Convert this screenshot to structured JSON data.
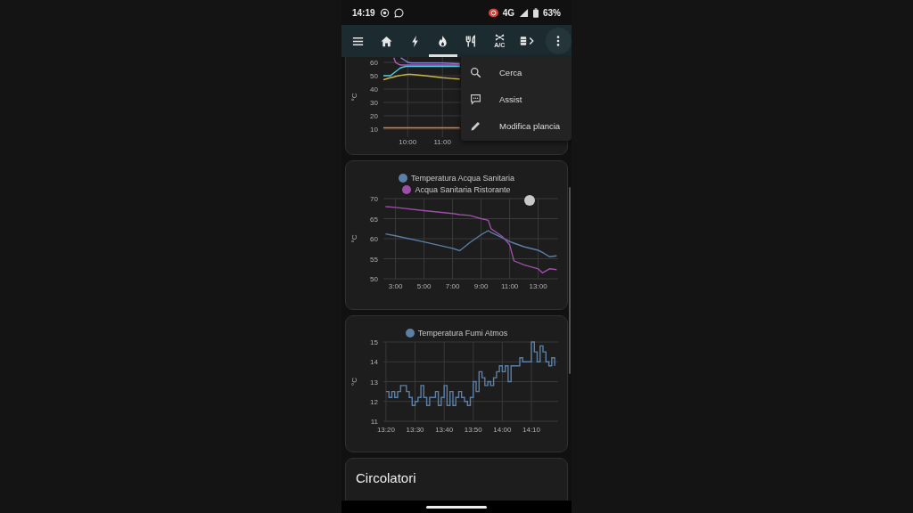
{
  "status_bar": {
    "time": "14:19",
    "network": "4G",
    "battery": "63%"
  },
  "nav_items": [
    {
      "kind": "menu",
      "selected": false
    },
    {
      "kind": "home",
      "selected": false
    },
    {
      "kind": "bolt",
      "selected": false
    },
    {
      "kind": "fire",
      "selected": true
    },
    {
      "kind": "cutlery",
      "selected": false
    },
    {
      "kind": "fan",
      "label": "A/C",
      "selected": false
    },
    {
      "kind": "device",
      "selected": false
    }
  ],
  "overflow_menu": {
    "items": [
      {
        "kind": "search",
        "label": "Cerca"
      },
      {
        "kind": "assist",
        "label": "Assist"
      },
      {
        "kind": "edit",
        "label": "Modifica plancia"
      }
    ]
  },
  "cards": [
    {
      "chart_data": {
        "type": "line",
        "grid": true,
        "ylabel": "°C",
        "x": [
          9.3,
          9.5,
          9.6,
          9.65,
          9.75,
          9.8,
          9.95,
          10,
          10.1,
          10.5,
          11,
          11.5
        ],
        "xlim": [
          9.3,
          14.33
        ],
        "ylim": [
          4,
          64
        ],
        "yticks": [
          10,
          20,
          30,
          40,
          50,
          60
        ],
        "xticks": [
          {
            "value": 10,
            "label": "10:00"
          },
          {
            "value": 11,
            "label": "11:00"
          }
        ],
        "series": [
          {
            "color": "#b05cc0",
            "values": [
              null,
              null,
              63.5,
              60,
              58.5,
              58,
              58,
              58,
              58,
              58,
              58,
              58
            ]
          },
          {
            "color": "#7c7fd0",
            "values": [
              null,
              null,
              null,
              null,
              null,
              63.5,
              61,
              60,
              59.5,
              59.5,
              59.5,
              59
            ]
          },
          {
            "color": "#4dd0e1",
            "values": [
              50,
              50,
              52,
              53,
              55,
              56,
              57,
              57,
              57,
              57,
              57,
              57
            ]
          },
          {
            "color": "#c8b84a",
            "values": [
              47,
              48.5,
              49,
              49.5,
              50,
              50.3,
              50.8,
              51,
              51,
              50,
              48.5,
              47.5
            ]
          },
          {
            "color": "#e07b39",
            "values": [
              11,
              11,
              11,
              11,
              11,
              11,
              11,
              11,
              11,
              11,
              11,
              11
            ]
          }
        ]
      }
    },
    {
      "chart_data": {
        "type": "line",
        "grid": true,
        "ylabel": "°C",
        "x": [
          2.3,
          3,
          5,
          7,
          7.5,
          8.2,
          9,
          9.5,
          9.7,
          10.5,
          11,
          11.3,
          12,
          13,
          13.3,
          13.8,
          14.3
        ],
        "xlim": [
          2.15,
          14.4
        ],
        "ylim": [
          50,
          70
        ],
        "yticks": [
          50,
          55,
          60,
          65,
          70
        ],
        "xticks": [
          {
            "value": 3,
            "label": "3:00"
          },
          {
            "value": 5,
            "label": "5:00"
          },
          {
            "value": 7,
            "label": "7:00"
          },
          {
            "value": 9,
            "label": "9:00"
          },
          {
            "value": 11,
            "label": "11:00"
          },
          {
            "value": 13,
            "label": "13:00"
          }
        ],
        "series": [
          {
            "name": "Temperatura Acqua Sanitaria",
            "color": "#5b7fa6",
            "values": [
              61.2,
              60.7,
              59.2,
              57.6,
              57,
              59,
              61,
              62,
              61.6,
              60.2,
              59.3,
              58.9,
              58,
              57.1,
              56.6,
              55.5,
              55.7
            ]
          },
          {
            "name": "Acqua Sanitaria Ristorante",
            "color": "#9c4fa8",
            "values": [
              68,
              67.8,
              67,
              66.3,
              66,
              65.8,
              65,
              64.6,
              62.5,
              60.5,
              58.5,
              54.5,
              53.5,
              52.5,
              51.5,
              52.5,
              52.3
            ]
          }
        ]
      }
    },
    {
      "chart_data": {
        "type": "line",
        "grid": true,
        "ylabel": "°C",
        "x": [
          13.3333,
          13.35,
          13.35,
          13.3667,
          13.3667,
          13.3833,
          13.3833,
          13.4,
          13.4,
          13.4167,
          13.4167,
          13.4333,
          13.4333,
          13.45,
          13.45,
          13.4667,
          13.4667,
          13.4833,
          13.4833,
          13.5,
          13.5,
          13.5167,
          13.5167,
          13.5333,
          13.5333,
          13.55,
          13.55,
          13.5667,
          13.5667,
          13.5833,
          13.5833,
          13.6,
          13.6,
          13.6167,
          13.6167,
          13.6333,
          13.6333,
          13.65,
          13.65,
          13.6667,
          13.6667,
          13.6833,
          13.6833,
          13.7,
          13.7,
          13.7167,
          13.7167,
          13.7333,
          13.7333,
          13.75,
          13.75,
          13.7667,
          13.7667,
          13.7833,
          13.7833,
          13.8,
          13.8,
          13.8167,
          13.8167,
          13.8333,
          13.8333,
          13.85,
          13.85,
          13.8667,
          13.8667,
          13.8833,
          13.8833,
          13.9,
          13.9,
          13.9167,
          13.9167,
          13.9333,
          13.9333,
          13.95,
          13.95,
          13.9667,
          13.9667,
          13.9833,
          13.9833,
          14,
          14,
          14.0167,
          14.0167,
          14.0333,
          14.0333,
          14.05,
          14.05,
          14.0667,
          14.0667,
          14.0833,
          14.0833,
          14.1,
          14.1,
          14.1167,
          14.1167,
          14.1333,
          14.1333,
          14.15,
          14.15,
          14.1667,
          14.1667,
          14.1833,
          14.1833,
          14.2,
          14.2,
          14.2167,
          14.2167,
          14.2333,
          14.2333,
          14.25,
          14.25,
          14.2667,
          14.2667,
          14.2833,
          14.2833,
          14.3,
          14.3
        ],
        "xlim": [
          13.3183,
          14.32
        ],
        "ylim": [
          11,
          15
        ],
        "yticks": [
          11,
          12,
          13,
          14,
          15
        ],
        "xticks": [
          {
            "value": 13.3333,
            "label": "13:20"
          },
          {
            "value": 13.5,
            "label": "13:30"
          },
          {
            "value": 13.6667,
            "label": "13:40"
          },
          {
            "value": 13.8333,
            "label": "13:50"
          },
          {
            "value": 14,
            "label": "14:00"
          },
          {
            "value": 14.1667,
            "label": "14:10"
          }
        ],
        "series": [
          {
            "name": "Temperatura Fumi Atmos",
            "color": "#5b7fa6",
            "values": [
              12.5,
              12.5,
              12.2,
              12.2,
              12.5,
              12.5,
              12.2,
              12.2,
              12.5,
              12.5,
              12.8,
              12.8,
              12.8,
              12.8,
              12.5,
              12.5,
              12.2,
              12.2,
              11.8,
              11.8,
              12,
              12,
              12.2,
              12.2,
              12.8,
              12.8,
              12.2,
              12.2,
              11.8,
              11.8,
              12.2,
              12.2,
              12.2,
              12.2,
              12.5,
              12.5,
              11.8,
              11.8,
              12.2,
              12.2,
              12.8,
              12.8,
              11.8,
              11.8,
              12.5,
              12.5,
              11.8,
              11.8,
              12.2,
              12.2,
              12.5,
              12.5,
              12.2,
              12.2,
              12,
              12,
              11.8,
              11.8,
              12.2,
              12.2,
              13,
              13,
              12.5,
              12.5,
              13.5,
              13.5,
              13.2,
              13.2,
              12.8,
              12.8,
              13,
              13,
              12.8,
              12.8,
              13.2,
              13.2,
              13.5,
              13.5,
              13.8,
              13.8,
              13.5,
              13.5,
              13.8,
              13.8,
              13,
              13,
              13.8,
              13.8,
              13.8,
              13.8,
              13.8,
              13.8,
              14.2,
              14.2,
              14,
              14,
              14,
              14,
              14,
              14,
              15,
              15,
              14.5,
              14.5,
              14,
              14,
              14.8,
              14.8,
              14.5,
              14.5,
              14,
              14,
              13.8,
              13.8,
              14.2,
              14.2,
              13.8
            ]
          }
        ]
      }
    },
    {
      "title": "Circolatori"
    }
  ]
}
